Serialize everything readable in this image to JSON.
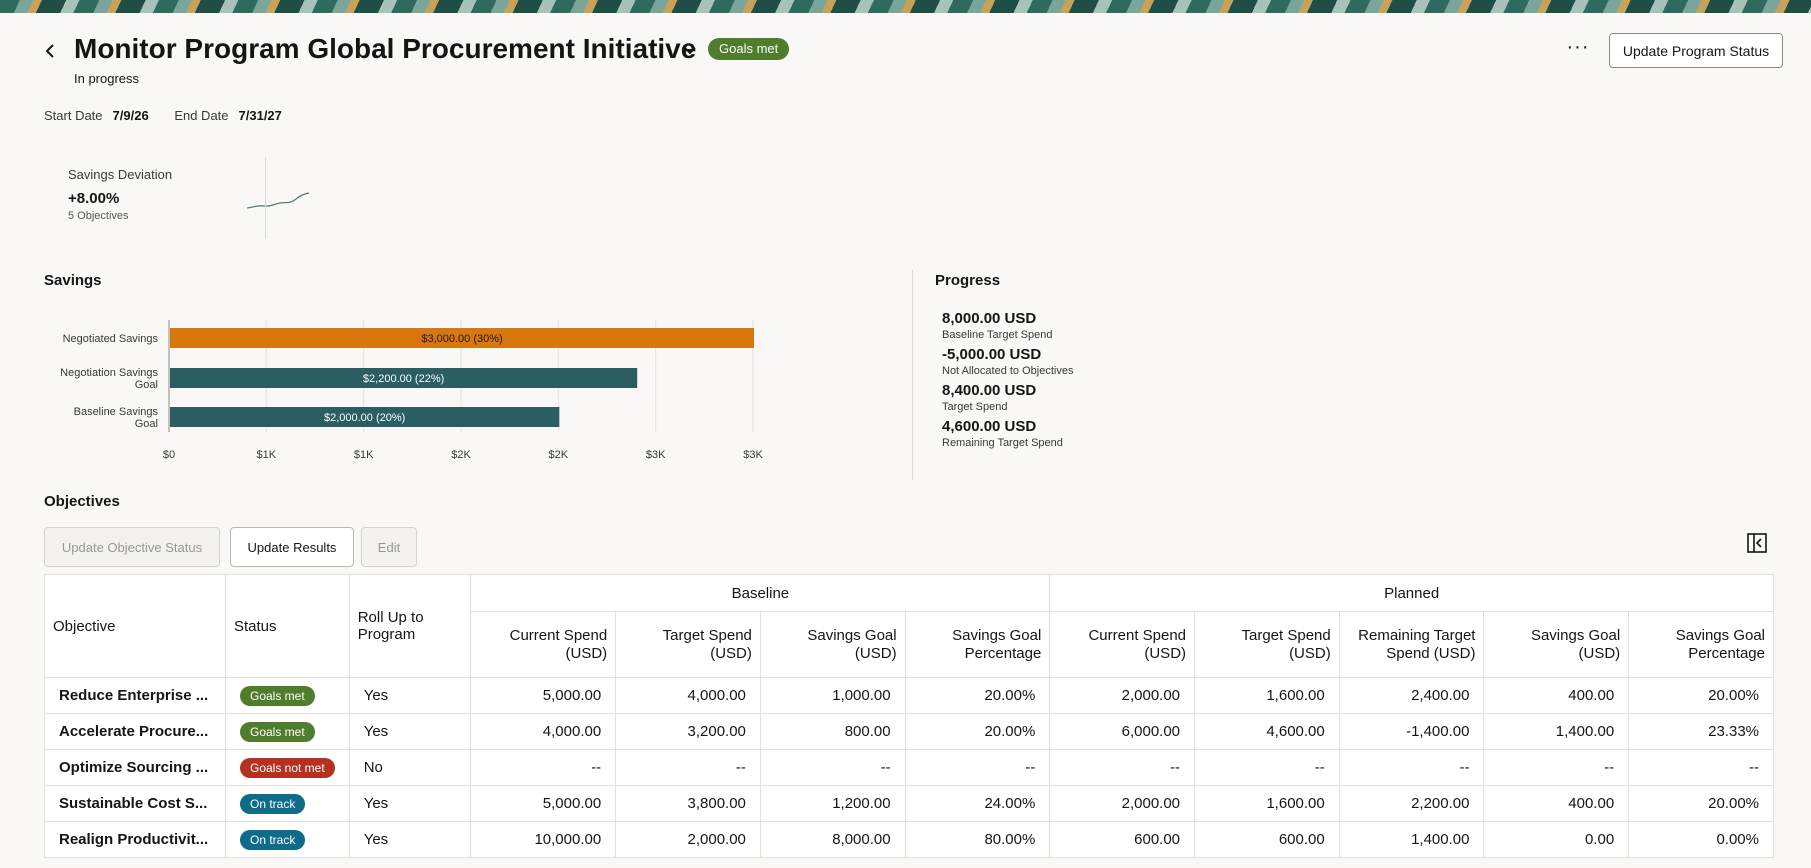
{
  "header": {
    "back_icon": "chevron-left-icon",
    "title": "Monitor Program Global Procurement Initiative",
    "title_menu_icon": "chevron-down-icon",
    "status_badge": "Goals met",
    "subtitle": "In progress",
    "more_icon": "···",
    "update_status_button": "Update Program Status"
  },
  "dates": {
    "start_label": "Start Date",
    "start_value": "7/9/26",
    "end_label": "End Date",
    "end_value": "7/31/27"
  },
  "kpi": {
    "title": "Savings Deviation",
    "value": "+8.00%",
    "sub": "5 Objectives"
  },
  "savings": {
    "title": "Savings"
  },
  "chart_data": {
    "type": "bar",
    "orientation": "horizontal",
    "categories": [
      "Negotiated Savings",
      "Negotiation Savings Goal",
      "Baseline Savings Goal"
    ],
    "values": [
      3000,
      2400,
      2000
    ],
    "data_labels": [
      "$3,000.00 (30%)",
      "$2,200.00 (22%)",
      "$2,000.00 (20%)"
    ],
    "colors": [
      "#d9770f",
      "#2b5e63",
      "#2b5e63"
    ],
    "x_ticks": [
      "$0",
      "$1K",
      "$1K",
      "$2K",
      "$2K",
      "$3K",
      "$3K"
    ],
    "xlim": [
      0,
      3000
    ],
    "grid": true
  },
  "progress": {
    "title": "Progress",
    "items": [
      {
        "value": "8,000.00 USD",
        "label": "Baseline Target Spend"
      },
      {
        "value": "-5,000.00 USD",
        "label": "Not Allocated to Objectives"
      },
      {
        "value": "8,400.00 USD",
        "label": "Target Spend"
      },
      {
        "value": "4,600.00 USD",
        "label": "Remaining Target Spend"
      }
    ]
  },
  "objectives": {
    "title": "Objectives",
    "toolbar": {
      "update_status": "Update Objective Status",
      "update_results": "Update Results",
      "edit": "Edit",
      "panel_icon": "panel-toggle-icon"
    },
    "group_headers": {
      "baseline": "Baseline",
      "planned": "Planned"
    },
    "columns": {
      "objective": "Objective",
      "status": "Status",
      "rollup": "Roll Up to Program",
      "b_current": "Current Spend (USD)",
      "b_target": "Target Spend (USD)",
      "b_goal": "Savings Goal (USD)",
      "b_pct": "Savings Goal Percentage",
      "p_current": "Current Spend (USD)",
      "p_target": "Target Spend (USD)",
      "p_remaining": "Remaining Target Spend (USD)",
      "p_goal": "Savings Goal (USD)",
      "p_pct": "Savings Goal Percentage"
    },
    "rows": [
      {
        "name": "Reduce Enterprise ...",
        "status": "Goals met",
        "status_kind": "met",
        "rollup": "Yes",
        "b_current": "5,000.00",
        "b_target": "4,000.00",
        "b_goal": "1,000.00",
        "b_pct": "20.00%",
        "p_current": "2,000.00",
        "p_target": "1,600.00",
        "p_remaining": "2,400.00",
        "p_goal": "400.00",
        "p_pct": "20.00%"
      },
      {
        "name": "Accelerate Procure...",
        "status": "Goals met",
        "status_kind": "met",
        "rollup": "Yes",
        "b_current": "4,000.00",
        "b_target": "3,200.00",
        "b_goal": "800.00",
        "b_pct": "20.00%",
        "p_current": "6,000.00",
        "p_target": "4,600.00",
        "p_remaining": "-1,400.00",
        "p_goal": "1,400.00",
        "p_pct": "23.33%"
      },
      {
        "name": "Optimize Sourcing ...",
        "status": "Goals not met",
        "status_kind": "notmet",
        "rollup": "No",
        "b_current": "--",
        "b_target": "--",
        "b_goal": "--",
        "b_pct": "--",
        "p_current": "--",
        "p_target": "--",
        "p_remaining": "--",
        "p_goal": "--",
        "p_pct": "--"
      },
      {
        "name": "Sustainable Cost S...",
        "status": "On track",
        "status_kind": "ontrack",
        "rollup": "Yes",
        "b_current": "5,000.00",
        "b_target": "3,800.00",
        "b_goal": "1,200.00",
        "b_pct": "24.00%",
        "p_current": "2,000.00",
        "p_target": "1,600.00",
        "p_remaining": "2,200.00",
        "p_goal": "400.00",
        "p_pct": "20.00%"
      },
      {
        "name": "Realign Productivit...",
        "status": "On track",
        "status_kind": "ontrack",
        "rollup": "Yes",
        "b_current": "10,000.00",
        "b_target": "2,000.00",
        "b_goal": "8,000.00",
        "b_pct": "80.00%",
        "p_current": "600.00",
        "p_target": "600.00",
        "p_remaining": "1,400.00",
        "p_goal": "0.00",
        "p_pct": "0.00%"
      }
    ]
  }
}
